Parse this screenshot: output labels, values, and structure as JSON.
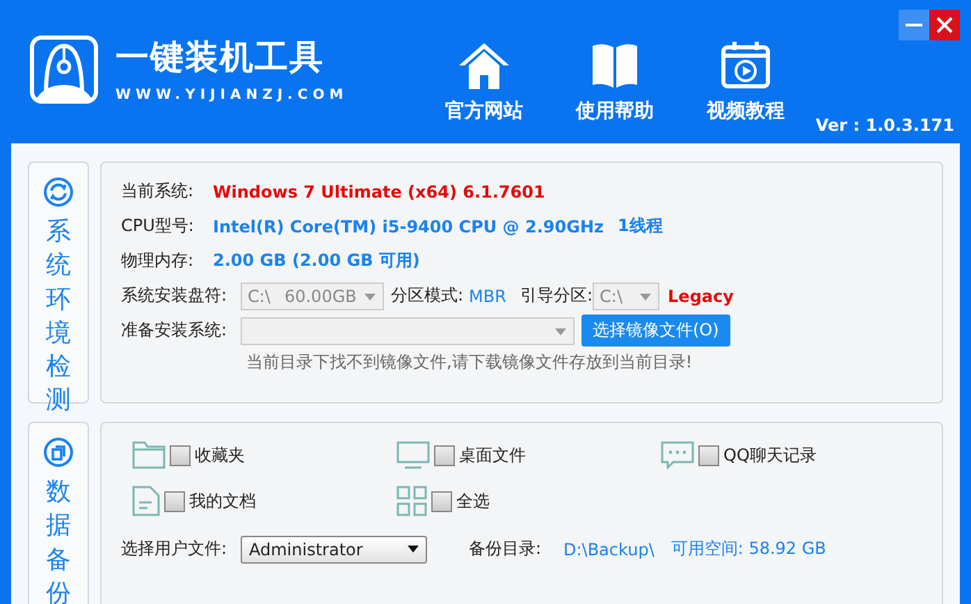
{
  "header": {
    "title": "一键装机工具",
    "url": "WWW.YIJIANZJ.COM",
    "version": "Ver : 1.0.3.171",
    "nav": [
      {
        "label": "官方网站",
        "kind": "home"
      },
      {
        "label": "使用帮助",
        "kind": "book"
      },
      {
        "label": "视频教程",
        "kind": "video"
      }
    ]
  },
  "system_section": {
    "title": "系统环境检测",
    "current_system": {
      "label": "当前系统:",
      "value": "Windows 7 Ultimate (x64) 6.1.7601"
    },
    "cpu": {
      "label": "CPU型号:",
      "value": "Intel(R) Core(TM) i5-9400 CPU @ 2.90GHz",
      "threads": "1线程"
    },
    "memory": {
      "label": "物理内存:",
      "value": "2.00 GB (2.00 GB 可用)"
    },
    "install_drive": {
      "label": "系统安装盘符:",
      "drive": "C:\\",
      "size": "60.00GB",
      "disabled": true
    },
    "partition_mode": {
      "label": "分区模式:",
      "value": "MBR"
    },
    "boot_partition": {
      "label": "引导分区:",
      "drive": "C:\\",
      "disabled": true,
      "mode": "Legacy"
    },
    "prepare": {
      "label": "准备安装系统:",
      "disabled": true,
      "button": "选择镜像文件(O)"
    },
    "notice": "当前目录下找不到镜像文件,请下载镜像文件存放到当前目录!"
  },
  "backup_section": {
    "title": "数据备份",
    "items": [
      {
        "label": "收藏夹",
        "kind": "folder",
        "checked": false
      },
      {
        "label": "桌面文件",
        "kind": "monitor",
        "checked": false
      },
      {
        "label": "QQ聊天记录",
        "kind": "chat",
        "checked": false
      },
      {
        "label": "我的文档",
        "kind": "document",
        "checked": false
      },
      {
        "label": "全选",
        "kind": "grid",
        "checked": false
      }
    ],
    "user": {
      "label": "选择用户文件:",
      "value": "Administrator"
    },
    "backup_dir": {
      "label": "备份目录:",
      "path": "D:\\Backup\\",
      "free": "可用空间: 58.92 GB"
    }
  }
}
